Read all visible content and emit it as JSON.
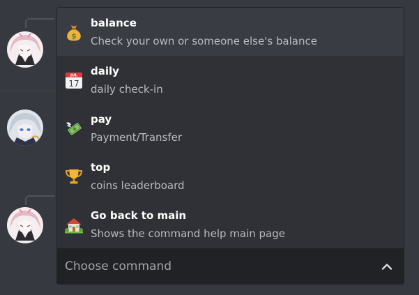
{
  "theme": {
    "background": "#36393f",
    "menu_background": "#2f3136",
    "menu_highlight": "#393c43",
    "select_bar": "#202225",
    "title_color": "#ffffff",
    "description_color": "#b9bbbe",
    "placeholder_color": "#a3a6aa"
  },
  "menu": {
    "options": [
      {
        "icon": "money-bag-icon",
        "title": "balance",
        "description": "Check your own or someone else's balance"
      },
      {
        "icon": "calendar-icon",
        "title": "daily",
        "description": "daily check-in"
      },
      {
        "icon": "money-with-wings-icon",
        "title": "pay",
        "description": "Payment/Transfer"
      },
      {
        "icon": "trophy-icon",
        "title": "top",
        "description": "coins leaderboard"
      },
      {
        "icon": "house-with-garden-icon",
        "title": "Go back to main",
        "description": "Shows the command help main page"
      }
    ],
    "highlighted_option": "balance",
    "placeholder": "Choose command",
    "chevron": "chevron-up-icon"
  },
  "calendar_icon": {
    "month": "JUL",
    "day": "17"
  }
}
